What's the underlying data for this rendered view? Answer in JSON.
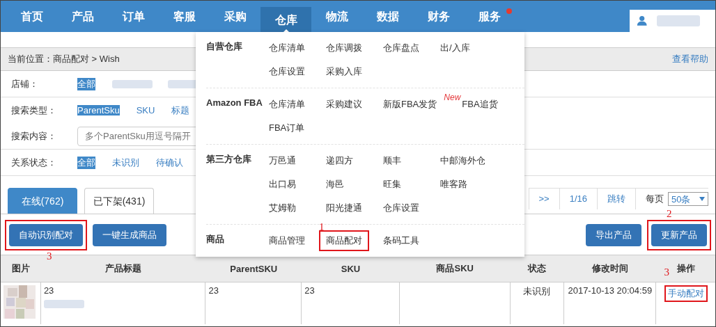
{
  "nav": {
    "items": [
      {
        "label": "首页",
        "selected": false,
        "dot": false
      },
      {
        "label": "产品",
        "selected": false,
        "dot": false
      },
      {
        "label": "订单",
        "selected": false,
        "dot": false
      },
      {
        "label": "客服",
        "selected": false,
        "dot": false
      },
      {
        "label": "采购",
        "selected": false,
        "dot": false
      },
      {
        "label": "仓库",
        "selected": true,
        "dot": false
      },
      {
        "label": "物流",
        "selected": false,
        "dot": false
      },
      {
        "label": "数据",
        "selected": false,
        "dot": false
      },
      {
        "label": "财务",
        "selected": false,
        "dot": false
      },
      {
        "label": "服务",
        "selected": false,
        "dot": true
      }
    ]
  },
  "breadcrumb": {
    "text": "当前位置：商品配对 > Wish",
    "help": "查看帮助"
  },
  "filters": [
    {
      "kind": "options",
      "label": "店铺：",
      "options": [
        {
          "label": "全部",
          "selected": true
        },
        {
          "redacted": true
        },
        {
          "redacted": true
        }
      ]
    },
    {
      "kind": "options",
      "label": "搜索类型：",
      "options": [
        {
          "label": "ParentSku",
          "selected": true
        },
        {
          "label": "SKU",
          "selected": false
        },
        {
          "label": "标题",
          "selected": false
        }
      ]
    },
    {
      "kind": "input",
      "label": "搜索内容：",
      "placeholder": "多个ParentSku用逗号隔开"
    },
    {
      "kind": "options",
      "label": "关系状态：",
      "options": [
        {
          "label": "全部",
          "selected": true
        },
        {
          "label": "未识别",
          "selected": false
        },
        {
          "label": "待确认",
          "selected": false
        }
      ]
    }
  ],
  "tabs": [
    {
      "label": "在线(762)",
      "selected": true
    },
    {
      "label": "已下架(431)",
      "selected": false
    }
  ],
  "pagination": {
    "items": [
      ">>",
      "1/16",
      "跳转"
    ],
    "per_page_label": "每页",
    "per_page": "50条"
  },
  "left_buttons": [
    {
      "label": "自动识别配对",
      "highlighted": true,
      "callout": "3"
    },
    {
      "label": "一键生成商品",
      "highlighted": false
    }
  ],
  "right_buttons": [
    {
      "label": "导出产品",
      "highlighted": false
    },
    {
      "label": "更新产品",
      "highlighted": true,
      "callout": "2"
    }
  ],
  "table": {
    "columns": [
      "图片",
      "产品标题",
      "ParentSKU",
      "SKU",
      "商品SKU",
      "状态",
      "修改时间",
      "操作"
    ],
    "rows": [
      {
        "title": "23",
        "title_redacted": true,
        "parent_sku": "23",
        "sku": "23",
        "status": "未识别",
        "modified": "2017-10-13 20:04:59",
        "action": {
          "label": "手动配对",
          "highlighted": true,
          "callout": "3"
        }
      }
    ]
  },
  "dropdown": {
    "sections": [
      {
        "heading": "自营仓库",
        "items": [
          {
            "label": "仓库清单"
          },
          {
            "label": "仓库调拨"
          },
          {
            "label": "仓库盘点"
          },
          {
            "label": "出/入库"
          },
          {
            "label": "仓库设置"
          },
          {
            "label": "采购入库"
          }
        ]
      },
      {
        "heading": "Amazon FBA",
        "items": [
          {
            "label": "仓库清单"
          },
          {
            "label": "采购建议"
          },
          {
            "label": "新版FBA发货",
            "badge": "New"
          },
          {
            "label": "FBA追货"
          },
          {
            "label": "FBA订单"
          }
        ]
      },
      {
        "heading": "第三方仓库",
        "items": [
          {
            "label": "万邑通"
          },
          {
            "label": "递四方"
          },
          {
            "label": "顺丰"
          },
          {
            "label": "中邮海外仓"
          },
          {
            "label": "出口易"
          },
          {
            "label": "海邑"
          },
          {
            "label": "旺集"
          },
          {
            "label": "唯客路"
          },
          {
            "label": "艾姆勒"
          },
          {
            "label": "阳光捷通"
          },
          {
            "label": "仓库设置"
          }
        ]
      },
      {
        "heading": "商品",
        "items": [
          {
            "label": "商品管理"
          },
          {
            "label": "商品配对",
            "highlighted": true,
            "callout": "1"
          },
          {
            "label": "条码工具"
          }
        ]
      }
    ]
  }
}
